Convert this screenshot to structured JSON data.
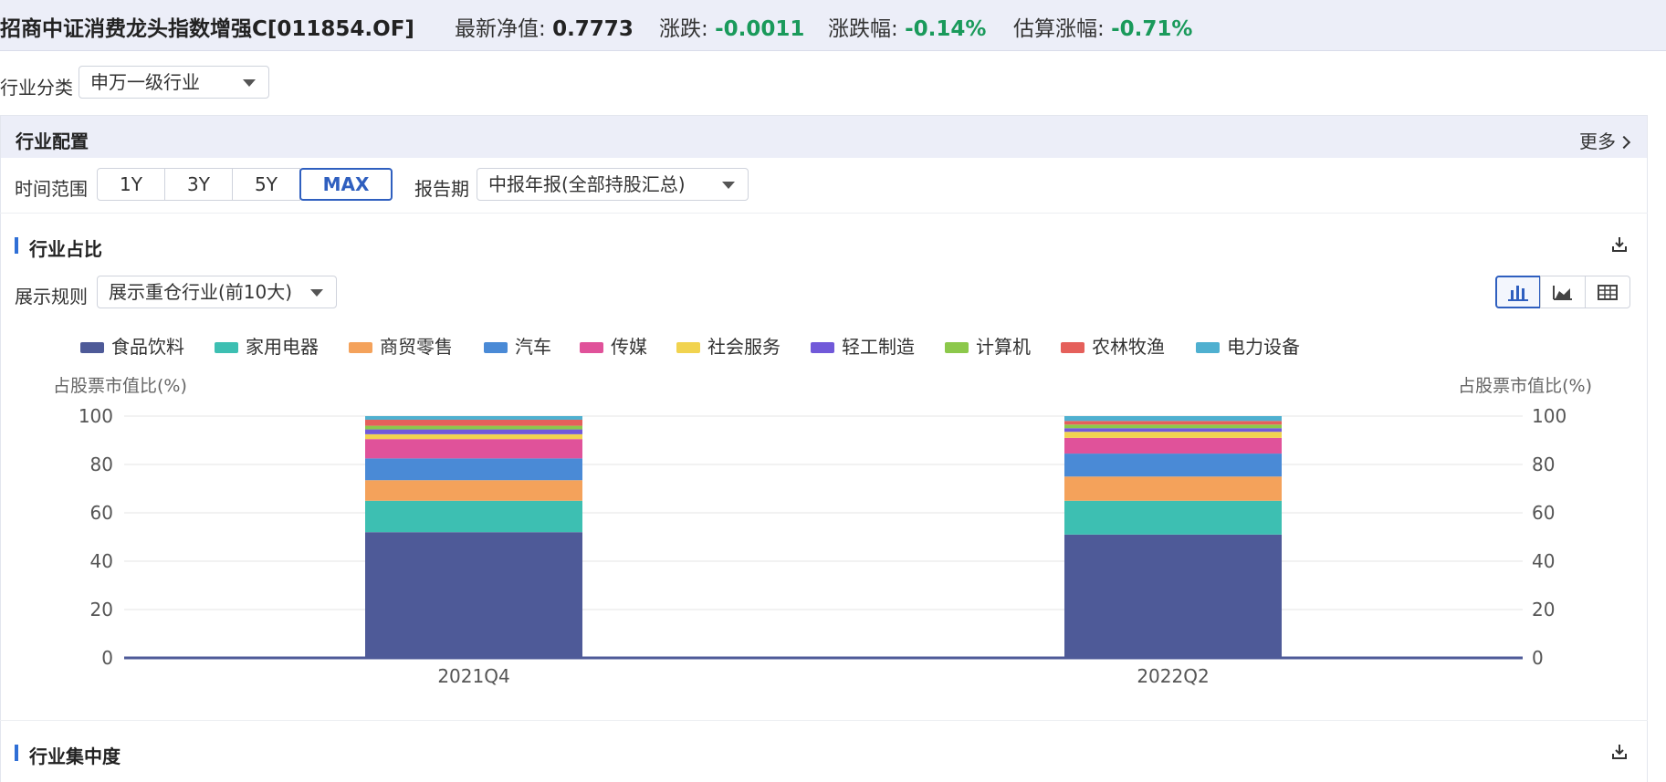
{
  "header": {
    "fund_name": "招商中证消费龙头指数增强C[011854.OF]",
    "nav_label": "最新净值: ",
    "nav_value": "0.7773",
    "change_label": "涨跌: ",
    "change_value": "-0.0011",
    "change_pct_label": "涨跌幅: ",
    "change_pct_value": "-0.14%",
    "est_label": "估算涨幅: ",
    "est_value": "-0.71%"
  },
  "filter": {
    "industry_class_label": "行业分类",
    "industry_class_value": "申万一级行业"
  },
  "panel": {
    "title": "行业配置",
    "more_label": "更多",
    "time_range_label": "时间范围",
    "ranges": [
      "1Y",
      "3Y",
      "5Y",
      "MAX"
    ],
    "active_range": "MAX",
    "report_period_label": "报告期",
    "report_period_value": "中报年报(全部持股汇总)"
  },
  "section_share": {
    "title": "行业占比",
    "display_rule_label": "展示规则",
    "display_rule_value": "展示重仓行业(前10大)",
    "views": [
      "bar-chart-icon",
      "area-chart-icon",
      "table-icon"
    ],
    "active_view": "bar-chart-icon"
  },
  "section_concentration": {
    "title": "行业集中度"
  },
  "colors": {
    "accent": "#2f5fbf",
    "negative": "#1a9a5b"
  },
  "chart_data": {
    "type": "bar",
    "stacked": true,
    "categories": [
      "2021Q4",
      "2022Q2"
    ],
    "ylabel": "占股票市值比(%)",
    "ylabel_right": "占股票市值比(%)",
    "ylim": [
      0,
      100
    ],
    "yticks": [
      0,
      20,
      40,
      60,
      80,
      100
    ],
    "grid": true,
    "legend_position": "top-left",
    "series": [
      {
        "name": "食品饮料",
        "color": "#4e5a98",
        "values": [
          52,
          51
        ]
      },
      {
        "name": "家用电器",
        "color": "#3dbfb2",
        "values": [
          13,
          14
        ]
      },
      {
        "name": "商贸零售",
        "color": "#f4a25b",
        "values": [
          8.5,
          10
        ]
      },
      {
        "name": "汽车",
        "color": "#4a8ad6",
        "values": [
          9,
          9.5
        ]
      },
      {
        "name": "传媒",
        "color": "#e0529a",
        "values": [
          8,
          6.5
        ]
      },
      {
        "name": "社会服务",
        "color": "#f1d34f",
        "values": [
          2,
          2.5
        ]
      },
      {
        "name": "轻工制造",
        "color": "#7159d9",
        "values": [
          2,
          1.5
        ]
      },
      {
        "name": "计算机",
        "color": "#8cc84b",
        "values": [
          1.5,
          1.5
        ]
      },
      {
        "name": "农林牧渔",
        "color": "#e5605b",
        "values": [
          2.5,
          1.5
        ]
      },
      {
        "name": "电力设备",
        "color": "#4fb0d0",
        "values": [
          1.5,
          2
        ]
      }
    ]
  }
}
